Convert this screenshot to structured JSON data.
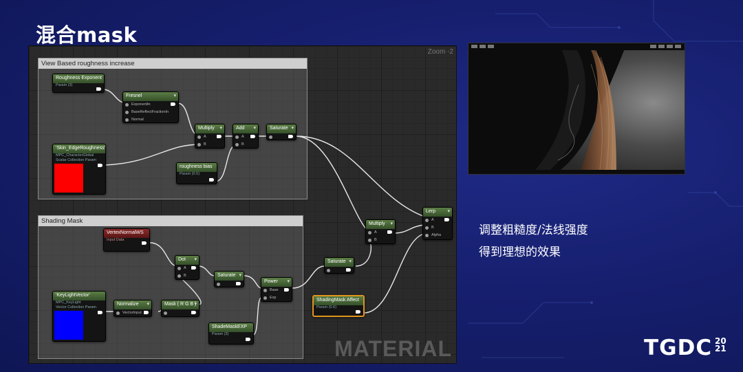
{
  "slide": {
    "title": "混合mask",
    "bullets": [
      "调整粗糙度/法线强度",
      "得到理想的效果"
    ],
    "logo": "TGDC",
    "logo_year_top": "20",
    "logo_year_bottom": "21"
  },
  "editor": {
    "zoom": "Zoom -2",
    "watermark": "MATERIAL",
    "comments": {
      "top": "View Based roughness increase",
      "bottom": "Shading Mask"
    },
    "nodes": {
      "roughness_exponent": {
        "title": "Roughness Exponent",
        "sub": "Param (3)"
      },
      "fresnel": {
        "title": "Fresnel",
        "inputs": [
          "Exponentln",
          "BaseReflectFractionIn",
          "Normal"
        ]
      },
      "skin_edge_roughness": {
        "title": "'Skin_EdgeRoughness'",
        "sub1": "MPC_CharacterGlobal",
        "sub2": "Scalar Collection Param"
      },
      "multiply_top": {
        "title": "Multiply",
        "inputs": [
          "A",
          "B"
        ]
      },
      "add": {
        "title": "Add",
        "inputs": [
          "A",
          "B"
        ]
      },
      "saturate_top": {
        "title": "Saturate"
      },
      "roughness_bias": {
        "title": "roughness bias",
        "sub": "Param (0.5)"
      },
      "lerp": {
        "title": "Lerp",
        "inputs": [
          "A",
          "B",
          "Alpha"
        ]
      },
      "multiply_mid": {
        "title": "Multiply",
        "inputs": [
          "A",
          "B"
        ]
      },
      "vertex_normal": {
        "title": "VertexNormalWS",
        "sub": "Input Data"
      },
      "dot": {
        "title": "Dot",
        "inputs": [
          "A",
          "B"
        ]
      },
      "saturate_mid": {
        "title": "Saturate"
      },
      "saturate_right": {
        "title": "Saturate"
      },
      "power": {
        "title": "Power",
        "inputs": [
          "Base",
          "Exp"
        ]
      },
      "key_light_vector": {
        "title": "'KeyLightVector'",
        "sub1": "MPC_KeyLight",
        "sub2": "Vector Collection Param"
      },
      "normalize": {
        "title": "Normalize",
        "inputs": [
          "VectorInput"
        ]
      },
      "mask_rgb": {
        "title": "Mask ( R G B )"
      },
      "shading_mask_affect": {
        "title": "ShadingMask Affect",
        "sub": "Param (0.6)"
      },
      "shade_mask_exp": {
        "title": "ShadeMaskEXP",
        "sub": "Param (3)"
      }
    }
  },
  "colors": {
    "node_header": "#4f6f3c",
    "red_swatch": "#ff0000",
    "blue_swatch": "#0000ff",
    "selected_outline": "#e0951e",
    "background": "#1a237e"
  }
}
